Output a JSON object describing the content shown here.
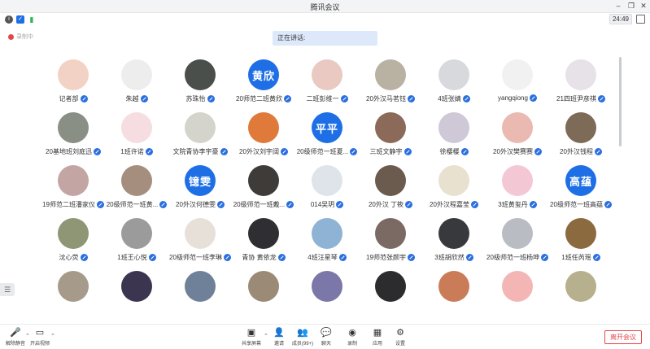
{
  "window": {
    "title": "腾讯会议"
  },
  "infobar": {
    "timer": "24:49"
  },
  "recording": {
    "label": "录制中"
  },
  "speaking": {
    "label": "正在讲话:"
  },
  "participants": [
    {
      "name": "记者部",
      "avatar_text": "",
      "color": "#f2d2c4"
    },
    {
      "name": "朱越",
      "avatar_text": "",
      "color": "#ededed"
    },
    {
      "name": "苏珠怡",
      "avatar_text": "",
      "color": "#4a4f4c"
    },
    {
      "name": "20师范二班黄欣",
      "avatar_text": "黄欣",
      "color": "#1e6fe6"
    },
    {
      "name": "二班彭维一",
      "avatar_text": "",
      "color": "#e9c9c2"
    },
    {
      "name": "20外汉马茗钰",
      "avatar_text": "",
      "color": "#b9b2a3"
    },
    {
      "name": "4班张婧",
      "avatar_text": "",
      "color": "#d7d9dd"
    },
    {
      "name": "yangqiong",
      "avatar_text": "",
      "color": "#f1f1f1"
    },
    {
      "name": "21四班尹彦祺",
      "avatar_text": "",
      "color": "#e6e2e8"
    },
    {
      "name": "20基地班刘庭迅",
      "avatar_text": "",
      "color": "#8a8f86"
    },
    {
      "name": "1班许诺",
      "avatar_text": "",
      "color": "#f5dde2"
    },
    {
      "name": "文院青协李宇豪",
      "avatar_text": "",
      "color": "#d4d4cc"
    },
    {
      "name": "20外汉刘宇阔",
      "avatar_text": "",
      "color": "#e07a3a"
    },
    {
      "name": "20级师范一班夏...",
      "avatar_text": "平平",
      "color": "#1e6fe6"
    },
    {
      "name": "三班文静宇",
      "avatar_text": "",
      "color": "#8c6a5a"
    },
    {
      "name": "徐樱樱",
      "avatar_text": "",
      "color": "#cfc8d6"
    },
    {
      "name": "20外汉樊赛赛",
      "avatar_text": "",
      "color": "#e9b9b2"
    },
    {
      "name": "20外汉钱程",
      "avatar_text": "",
      "color": "#7d6a57"
    },
    {
      "name": "19师范二班潘家仪",
      "avatar_text": "",
      "color": "#c3a6a4"
    },
    {
      "name": "20级师范一班黄...",
      "avatar_text": "",
      "color": "#a58e7d"
    },
    {
      "name": "20外汉何德雯",
      "avatar_text": "镱雯",
      "color": "#1e6fe6"
    },
    {
      "name": "20级师范一班戴...",
      "avatar_text": "",
      "color": "#3e3b39"
    },
    {
      "name": "014吴玥",
      "avatar_text": "",
      "color": "#dfe3ea"
    },
    {
      "name": "20外汉 丁筱",
      "avatar_text": "",
      "color": "#6b5a4e"
    },
    {
      "name": "20外汉程嘉莹",
      "avatar_text": "",
      "color": "#e9e1cf"
    },
    {
      "name": "3班黄玺丹",
      "avatar_text": "",
      "color": "#f3c7d3"
    },
    {
      "name": "20级师范一班高蕴",
      "avatar_text": "高蕴",
      "color": "#1e6fe6"
    },
    {
      "name": "沈心荧",
      "avatar_text": "",
      "color": "#8f9676"
    },
    {
      "name": "1班王心悦",
      "avatar_text": "",
      "color": "#9b9b9b"
    },
    {
      "name": "20级师范一班李琳",
      "avatar_text": "",
      "color": "#e7e0d8"
    },
    {
      "name": "青协 黄依龙",
      "avatar_text": "",
      "color": "#2f2f33"
    },
    {
      "name": "4班汪星琴",
      "avatar_text": "",
      "color": "#8fb3d4"
    },
    {
      "name": "19师范张颜宇",
      "avatar_text": "",
      "color": "#7a6a63"
    },
    {
      "name": "3班胡欣然",
      "avatar_text": "",
      "color": "#38393d"
    },
    {
      "name": "20级师范一班杨坤",
      "avatar_text": "",
      "color": "#b9bcc2"
    },
    {
      "name": "1班任芮瑶",
      "avatar_text": "",
      "color": "#8c6a3f"
    },
    {
      "name": "",
      "avatar_text": "",
      "color": "#a69a8a"
    },
    {
      "name": "",
      "avatar_text": "",
      "color": "#3b3550"
    },
    {
      "name": "",
      "avatar_text": "",
      "color": "#6f8198"
    },
    {
      "name": "",
      "avatar_text": "",
      "color": "#9a8a76"
    },
    {
      "name": "",
      "avatar_text": "",
      "color": "#7b77a8"
    },
    {
      "name": "",
      "avatar_text": "",
      "color": "#2c2b2d"
    },
    {
      "name": "",
      "avatar_text": "",
      "color": "#c97c57"
    },
    {
      "name": "",
      "avatar_text": "",
      "color": "#f4b5b5"
    },
    {
      "name": "",
      "avatar_text": "",
      "color": "#b6b08e"
    }
  ],
  "toolbar": {
    "unmute": "解除静音",
    "start_video": "开启视频",
    "share_screen": "共享屏幕",
    "invite": "邀请",
    "members": "成员(99+)",
    "chat": "聊天",
    "record": "录制",
    "apps": "应用",
    "settings": "设置",
    "leave": "离开会议"
  },
  "colors": {
    "accent": "#1e6fe6",
    "danger": "#e4464b"
  }
}
